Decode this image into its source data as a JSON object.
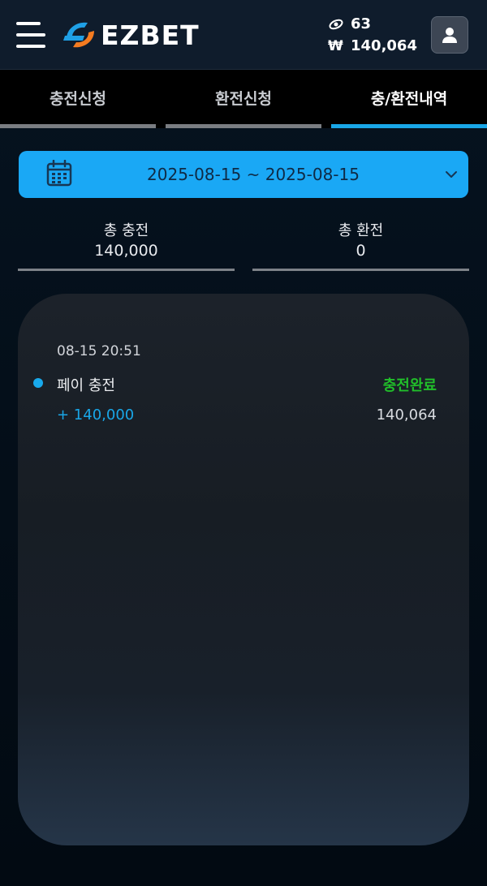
{
  "header": {
    "logo_text": "EZBET",
    "points_value": "63",
    "currency_symbol": "₩",
    "cash_value": "140,064",
    "icons": {
      "menu": "hamburger-menu-icon",
      "points": "e-coin-icon",
      "profile": "user-icon"
    }
  },
  "tabs": [
    {
      "label": "충전신청",
      "active": false
    },
    {
      "label": "환전신청",
      "active": false
    },
    {
      "label": "충/환전내역",
      "active": true
    }
  ],
  "date_filter": {
    "start": "2025-08-15",
    "separator": "~",
    "end": "2025-08-15",
    "range_text": "2025-08-15  ~  2025-08-15"
  },
  "totals": {
    "deposit_label": "총 충전",
    "deposit_value": "140,000",
    "withdraw_label": "총 환전",
    "withdraw_value": "0"
  },
  "transactions": [
    {
      "time": "08-15 20:51",
      "title": "페이 충전",
      "status": "충전완료",
      "amount": "+ 140,000",
      "balance": "140,064"
    }
  ],
  "colors": {
    "accent": "#19a7e8",
    "date_bar": "#1aa8f5",
    "status_complete": "#21bf2a",
    "header_bg": "#0f1c2c"
  }
}
